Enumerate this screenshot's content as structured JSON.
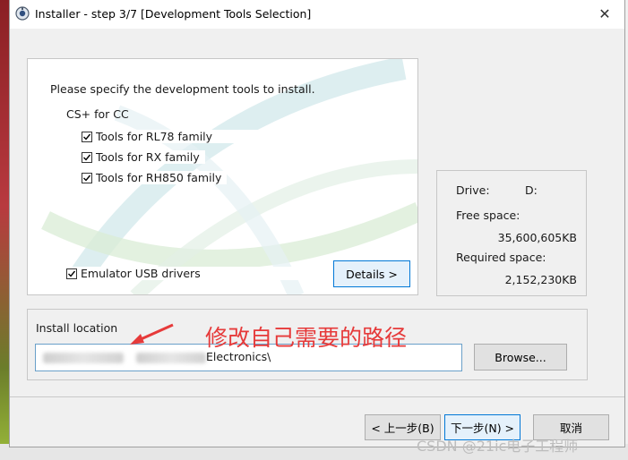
{
  "window": {
    "title": "Installer - step 3/7 [Development Tools Selection]",
    "close_glyph": "✕"
  },
  "tools": {
    "instruction": "Please specify the development tools to install.",
    "group_label": "CS+ for CC",
    "items": [
      {
        "label": "Tools for RL78 family",
        "checked": true
      },
      {
        "label": "Tools for RX family",
        "checked": true
      },
      {
        "label": "Tools for RH850 family",
        "checked": true
      }
    ],
    "emulator": {
      "label": "Emulator USB drivers",
      "checked": true
    },
    "details_button": "Details >"
  },
  "drive": {
    "drive_label": "Drive:",
    "drive_value": "D:",
    "free_label": "Free space:",
    "free_value": "35,600,605KB",
    "required_label": "Required space:",
    "required_value": "2,152,230KB"
  },
  "install": {
    "label": "Install location",
    "path_visible": "Electronics\\",
    "browse_button": "Browse..."
  },
  "annotation": {
    "text": "修改自己需要的路径",
    "color": "#e63a3a"
  },
  "nav": {
    "back_button": "< 上一步(B)",
    "next_button": "下一步(N) >",
    "cancel_button": "取消"
  },
  "watermark": "CSDN @21ic电子工程师",
  "icons": {
    "app": "installer-app-icon",
    "close": "close-icon",
    "arrow": "red-arrow-icon"
  },
  "colors": {
    "accent": "#0078d7",
    "annotation_red": "#e63a3a"
  }
}
